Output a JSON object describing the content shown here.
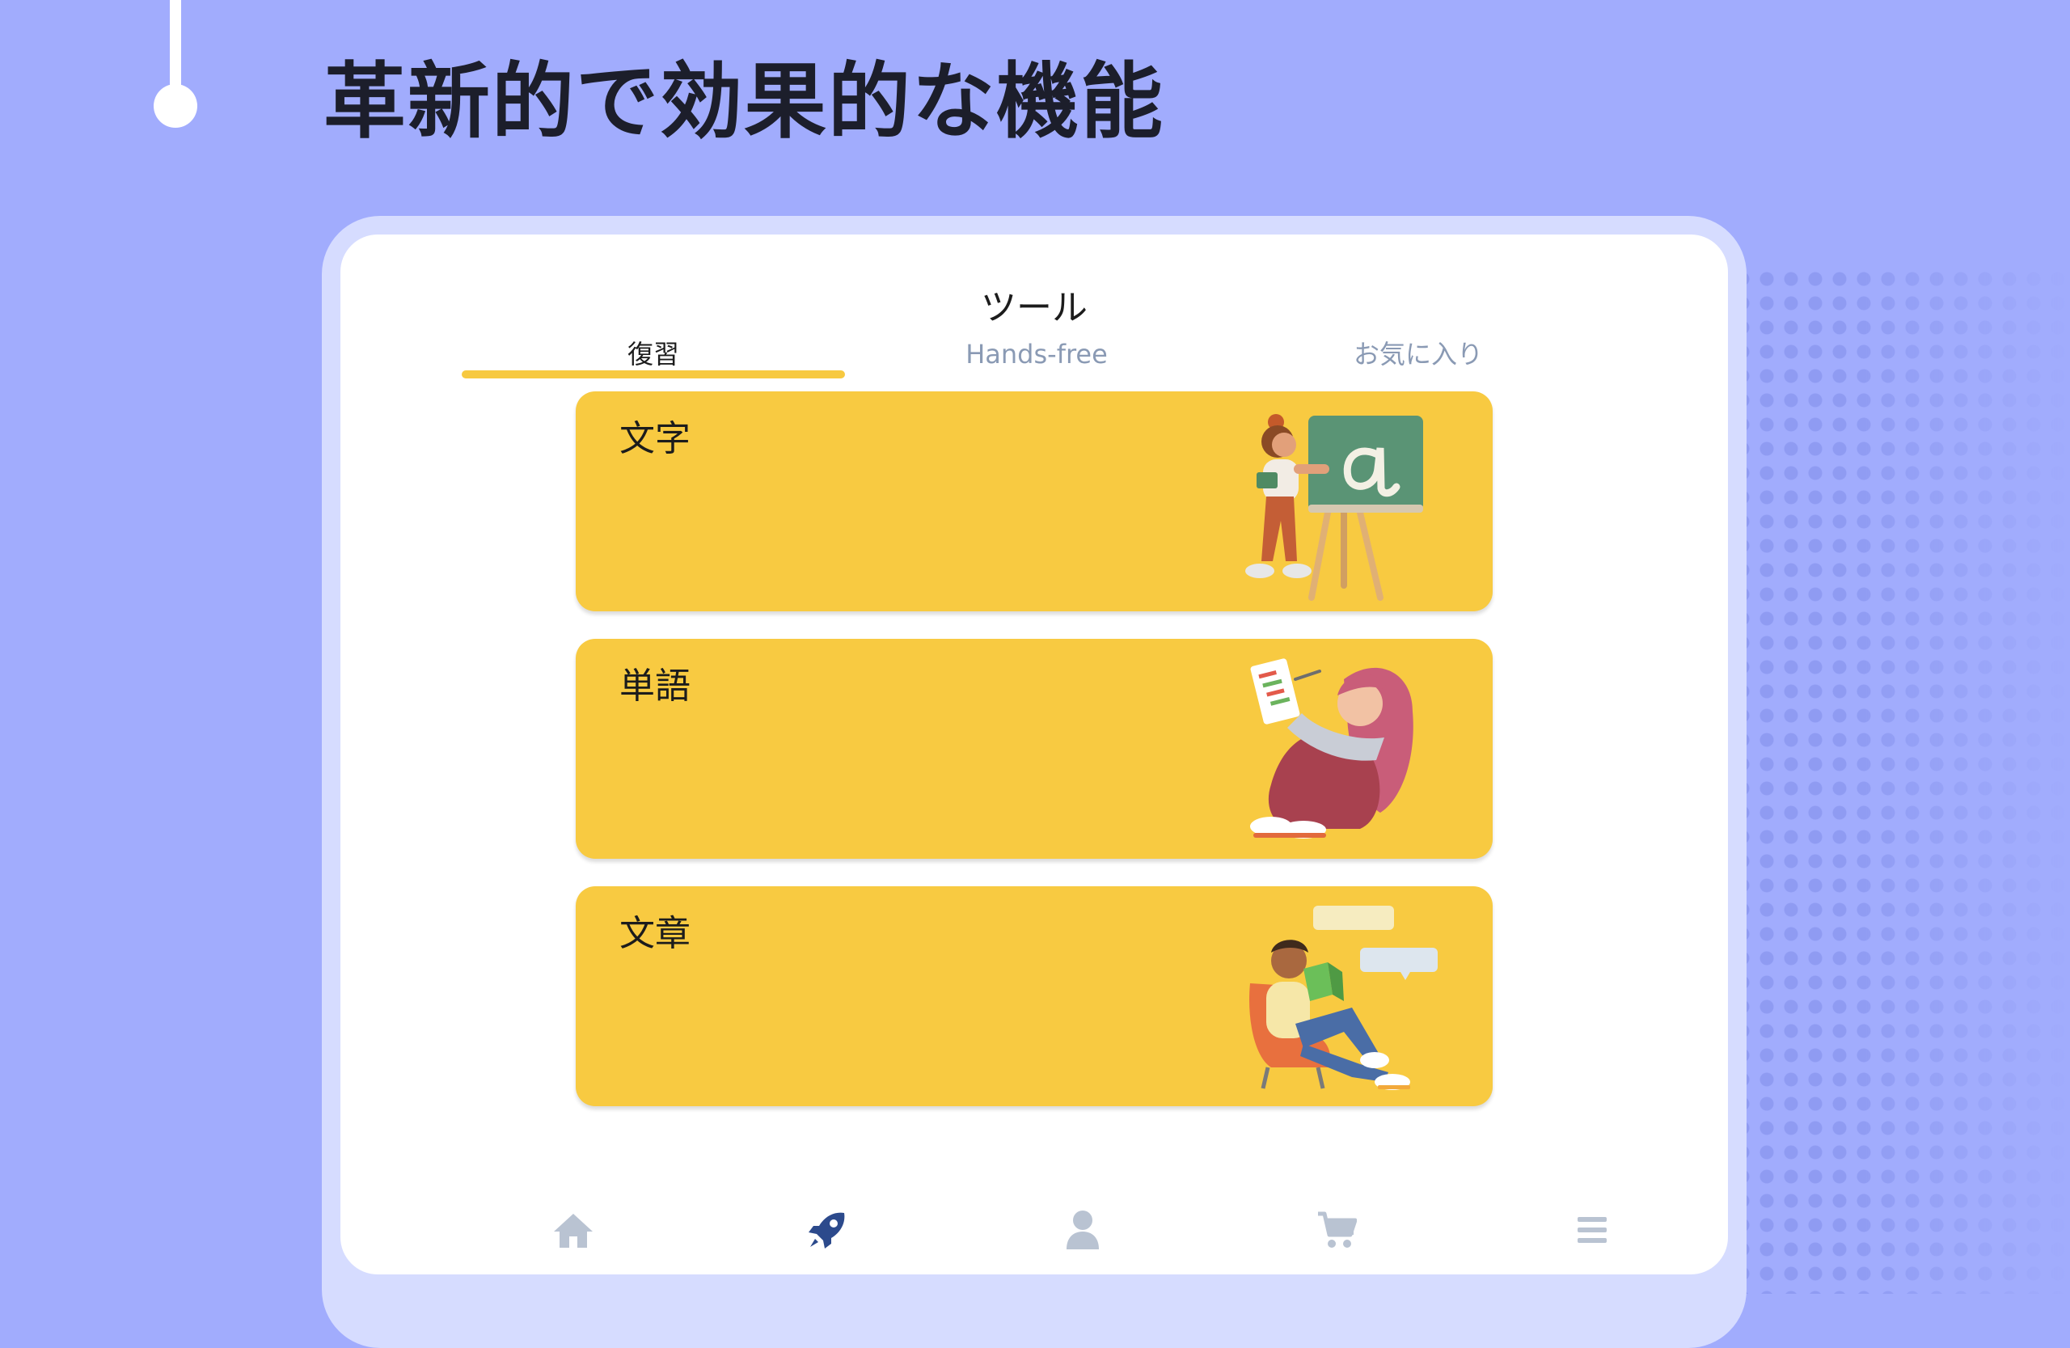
{
  "headline": "革新的で効果的な機能",
  "screen": {
    "title": "ツール",
    "tabs": [
      {
        "label": "復習",
        "active": true
      },
      {
        "label": "Hands-free",
        "active": false
      },
      {
        "label": "お気に入り",
        "active": false
      }
    ],
    "cards": [
      {
        "label": "文字",
        "icon": "teacher-chalkboard-illustration"
      },
      {
        "label": "単語",
        "icon": "girl-holding-word-list-illustration"
      },
      {
        "label": "文章",
        "icon": "boy-reading-book-illustration"
      }
    ]
  },
  "bottom_nav": [
    {
      "icon": "home-icon",
      "active": false
    },
    {
      "icon": "rocket-icon",
      "active": true
    },
    {
      "icon": "profile-icon",
      "active": false
    },
    {
      "icon": "cart-icon",
      "active": false
    },
    {
      "icon": "menu-icon",
      "active": false
    }
  ],
  "colors": {
    "background": "#a1acfd",
    "card": "#f8ca41",
    "accent": "#f7c940",
    "nav_active": "#2c4a8c",
    "nav_inactive": "#b9c3d2"
  }
}
